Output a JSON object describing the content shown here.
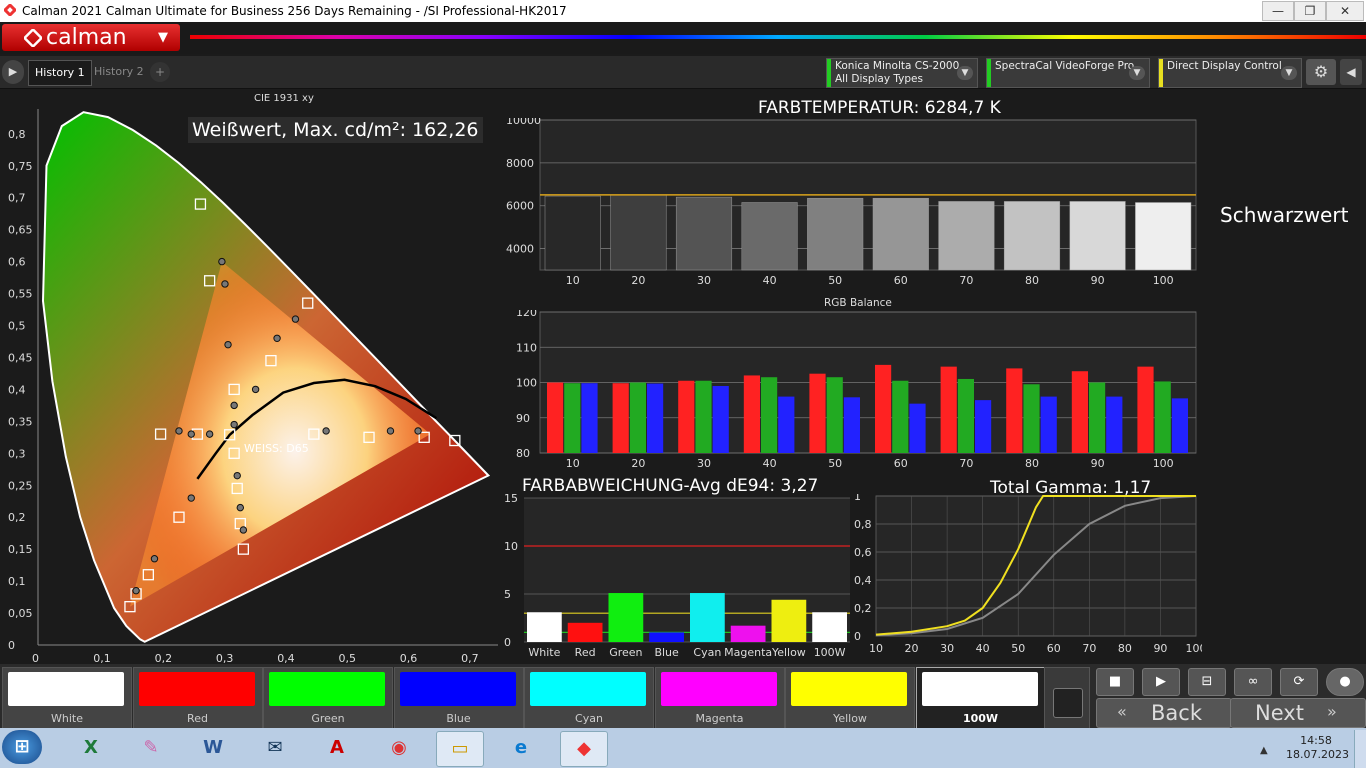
{
  "window": {
    "title": "Calman 2021 Calman Ultimate for Business 256 Days Remaining  - /SI Professional-HK2017",
    "minimize": "—",
    "maximize": "❐",
    "close": "✕"
  },
  "brand": {
    "label": "calman"
  },
  "tabs": {
    "nav_arrow": "▶",
    "items": [
      {
        "label": "History 1"
      },
      {
        "label": "History 2"
      }
    ],
    "add": "+"
  },
  "devices": [
    {
      "line1": "Konica Minolta CS-2000",
      "line2": "All Display Types",
      "color": "#22cc22"
    },
    {
      "line1": "SpectraCal VideoForge Pro",
      "line2": "",
      "color": "#22cc22"
    },
    {
      "line1": "Direct Display Control",
      "line2": "",
      "color": "#e8e020"
    }
  ],
  "cie": {
    "title": "CIE 1931 xy",
    "white_max": "Weißwert, Max. cd/m²: 162,26",
    "white_label": "WEISS: D65",
    "x_ticks": [
      "0",
      "0,1",
      "0,2",
      "0,3",
      "0,4",
      "0,5",
      "0,6",
      "0,7"
    ],
    "y_ticks": [
      "0",
      "0,05",
      "0,1",
      "0,15",
      "0,2",
      "0,25",
      "0,3",
      "0,35",
      "0,4",
      "0,45",
      "0,5",
      "0,55",
      "0,6",
      "0,65",
      "0,7",
      "0,75",
      "0,8"
    ]
  },
  "colortemp": {
    "title": "FARBTEMPERATUR: 6284,7 K",
    "y_ticks": [
      "4000",
      "6000",
      "8000",
      "10000"
    ],
    "categories": [
      "10",
      "20",
      "30",
      "40",
      "50",
      "60",
      "70",
      "80",
      "90",
      "100"
    ],
    "values": [
      6450,
      6500,
      6400,
      6150,
      6350,
      6350,
      6200,
      6200,
      6200,
      6150
    ],
    "target": 6504
  },
  "schwarzwert": "Schwarzwert",
  "rgb": {
    "title": "RGB Balance",
    "y_ticks": [
      "80",
      "90",
      "100",
      "110",
      "120"
    ],
    "categories": [
      "10",
      "20",
      "30",
      "40",
      "50",
      "60",
      "70",
      "80",
      "90",
      "100"
    ],
    "red": [
      100,
      99.8,
      100.5,
      102,
      102.5,
      105,
      104.5,
      104,
      103.2,
      104.5
    ],
    "green": [
      99.8,
      100,
      100.5,
      101.5,
      101.5,
      100.5,
      101,
      99.5,
      100,
      100.3
    ],
    "blue": [
      99.8,
      99.7,
      99,
      96,
      95.8,
      94,
      95,
      96,
      96,
      95.5
    ]
  },
  "deltae": {
    "title": "FARBABWEICHUNG-Avg dE94: 3,27",
    "y_ticks": [
      "0",
      "5",
      "10",
      "15"
    ],
    "categories": [
      "White",
      "Red",
      "Green",
      "Blue",
      "Cyan",
      "Magenta",
      "Yellow",
      "100W"
    ],
    "values": [
      3.1,
      2.0,
      5.1,
      1.0,
      5.1,
      1.7,
      4.4,
      3.1
    ],
    "colors": [
      "#ffffff",
      "#ff1010",
      "#10ee10",
      "#1010ff",
      "#10eeee",
      "#ee10ee",
      "#eeee10",
      "#ffffff"
    ]
  },
  "gamma": {
    "title": "Total Gamma: 1,17",
    "y_ticks": [
      "0",
      "0,2",
      "0,4",
      "0,6",
      "0,8",
      "1"
    ],
    "x_ticks": [
      "10",
      "20",
      "30",
      "40",
      "50",
      "60",
      "70",
      "80",
      "90",
      "100"
    ]
  },
  "swatches": [
    {
      "label": "White",
      "color": "#ffffff"
    },
    {
      "label": "Red",
      "color": "#ff0000"
    },
    {
      "label": "Green",
      "color": "#00ff00"
    },
    {
      "label": "Blue",
      "color": "#0000ff"
    },
    {
      "label": "Cyan",
      "color": "#00ffff"
    },
    {
      "label": "Magenta",
      "color": "#ff00ff"
    },
    {
      "label": "Yellow",
      "color": "#ffff00"
    },
    {
      "label": "100W",
      "color": "#ffffff"
    }
  ],
  "controls": {
    "back": "Back",
    "next": "Next"
  },
  "clock": {
    "time": "14:58",
    "date": "18.07.2023"
  },
  "taskbar": {
    "start": "⊞",
    "excel": "X",
    "word": "W",
    "pdf": "A",
    "chrome": "◉",
    "folder": "▭",
    "edge": "e"
  }
}
